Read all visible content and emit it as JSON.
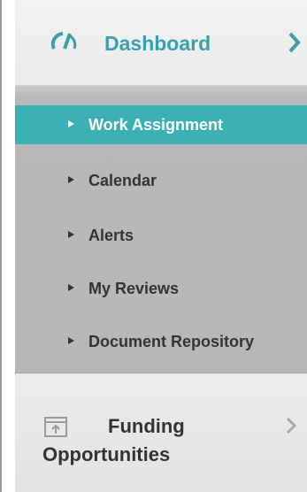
{
  "nav": {
    "dashboard": {
      "label": "Dashboard",
      "icon": "speedometer-icon",
      "chevron": "chevron-right-icon",
      "accent_color": "#3aa0ad"
    },
    "submenu": {
      "items": [
        {
          "label": "Work Assignment",
          "active": true
        },
        {
          "label": "Calendar",
          "active": false
        },
        {
          "label": "Alerts",
          "active": false
        },
        {
          "label": "My Reviews",
          "active": false
        },
        {
          "label": "Document Repository",
          "active": false
        }
      ],
      "active_color": "#3bb0b5"
    },
    "funding": {
      "label": "Funding Opportunities",
      "icon": "upload-window-icon",
      "chevron": "chevron-right-icon"
    }
  }
}
